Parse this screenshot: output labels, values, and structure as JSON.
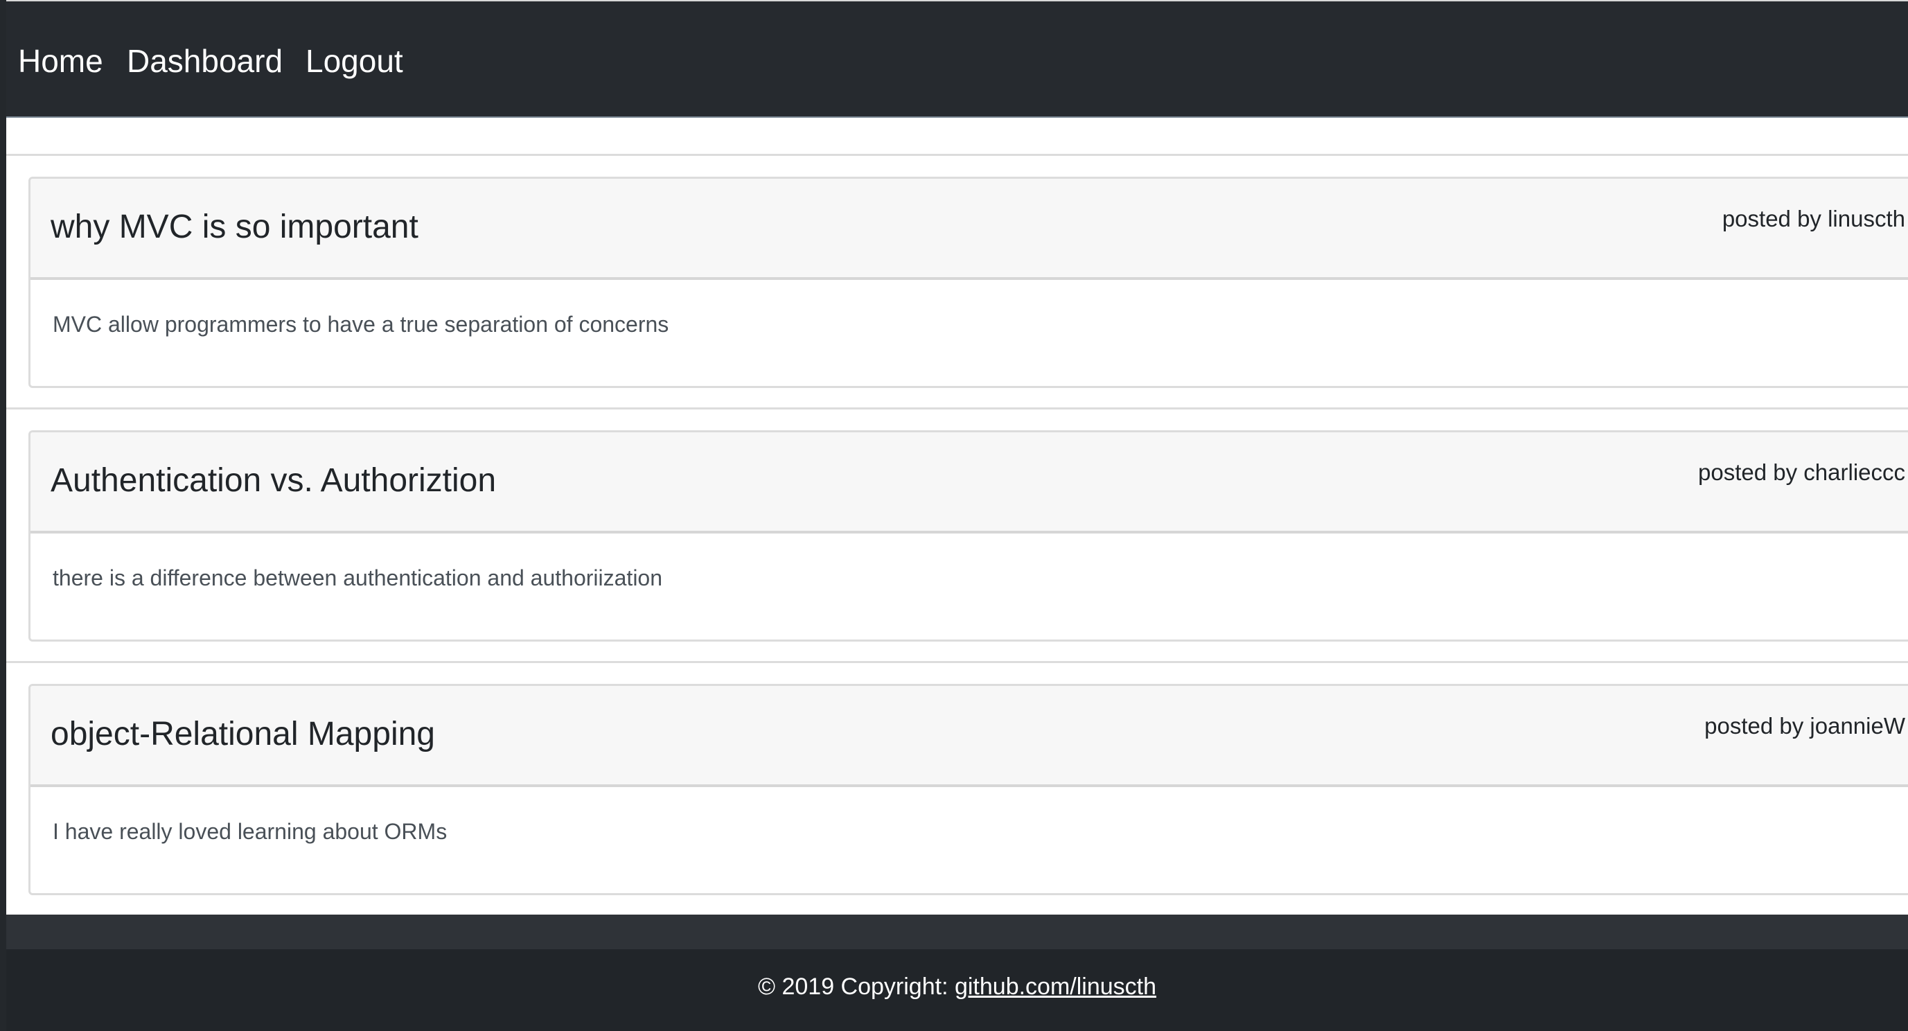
{
  "nav": {
    "home_label": "Home",
    "dashboard_label": "Dashboard",
    "logout_label": "Logout"
  },
  "posts": [
    {
      "title": "why MVC is so important",
      "author": "posted by linuscth",
      "body": "MVC allow programmers to have a true separation of concerns"
    },
    {
      "title": "Authentication vs. Authoriztion",
      "author": "posted by charlieccc",
      "body": "there is a difference between authentication and authoriization"
    },
    {
      "title": "object-Relational Mapping",
      "author": "posted by joannieW",
      "body": "I have really loved learning about ORMs"
    }
  ],
  "footer": {
    "copyright_prefix": "© 2019 Copyright: ",
    "link_text": "github.com/linuscth"
  },
  "colors": {
    "navbar_bg": "#262a2f",
    "footer_bg": "#212529",
    "card_header_bg": "#f7f7f7"
  }
}
